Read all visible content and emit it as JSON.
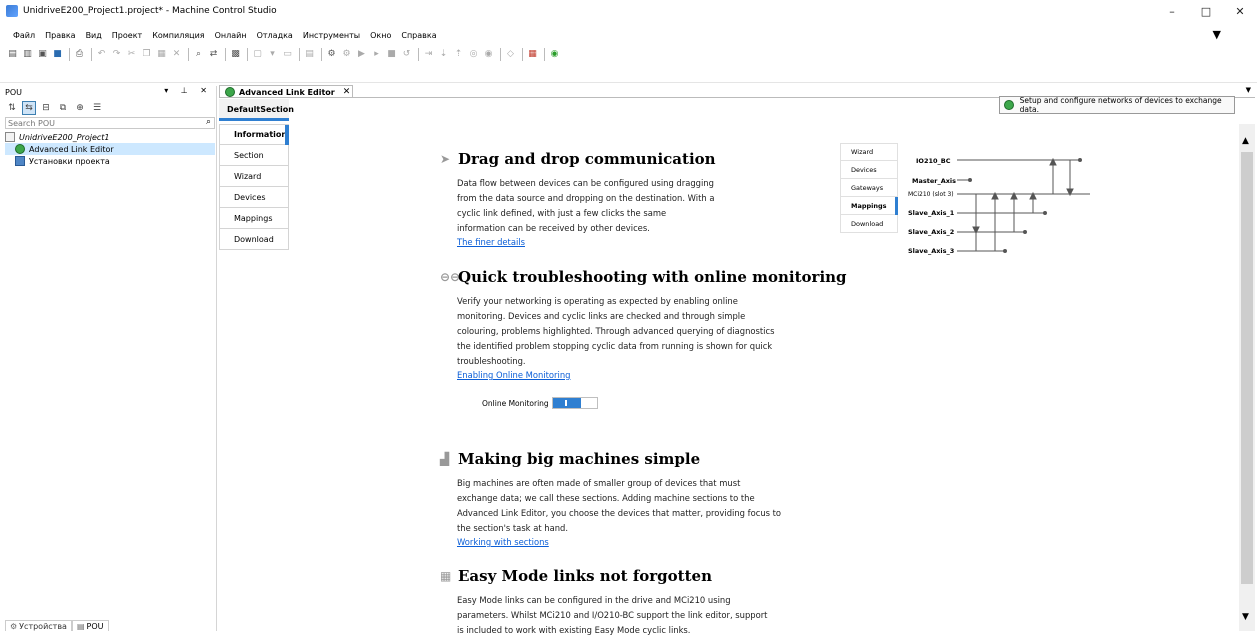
{
  "window": {
    "title": "UnidriveE200_Project1.project* - Machine Control Studio",
    "controls": [
      "–",
      "□",
      "✕"
    ]
  },
  "menu": [
    "Файл",
    "Правка",
    "Вид",
    "Проект",
    "Компиляция",
    "Онлайн",
    "Отладка",
    "Инструменты",
    "Окно",
    "Справка"
  ],
  "pou_panel": {
    "title": "POU",
    "controls": "▾ ⊥ ✕",
    "search_placeholder": "Search POU",
    "tree": {
      "project": "UnidriveE200_Project1",
      "items": [
        "Advanced Link Editor",
        "Установки проекта"
      ]
    },
    "bottom_tabs": [
      "Устройства",
      "POU"
    ]
  },
  "editor": {
    "tab_label": "Advanced Link Editor",
    "section_tab": "DefaultSection",
    "tooltip": "Setup and configure networks of devices to exchange data.",
    "nav": [
      "Information",
      "Section",
      "Wizard",
      "Devices",
      "Mappings",
      "Download"
    ],
    "active_nav": "Information"
  },
  "sections": [
    {
      "title": "Drag and drop communication",
      "icon": "cursor-icon",
      "lines": [
        "Data flow between devices can be configured using dragging",
        "from the data source and dropping on the destination. With a",
        "cyclic link defined, with just a few clicks the same",
        "information can be received by other devices."
      ],
      "link": "The finer details"
    },
    {
      "title": "Quick troubleshooting with online monitoring",
      "icon": "glasses-icon",
      "lines": [
        "Verify your networking is operating as expected by enabling online",
        "monitoring. Devices and cyclic links are checked and through simple",
        "colouring, problems highlighted. Through advanced querying of diagnostics",
        "the identified problem stopping cyclic data from running is shown for quick",
        "troubleshooting."
      ],
      "link": "Enabling Online Monitoring",
      "toggle_label": "Online Monitoring"
    },
    {
      "title": "Making big machines simple",
      "icon": "factory-icon",
      "lines": [
        "Big machines are often made of smaller group of devices that must",
        "exchange data; we call these sections. Adding machine sections to the",
        "Advanced Link Editor, you choose the devices that matter, providing focus to",
        "the section's task at hand."
      ],
      "link": "Working with sections"
    },
    {
      "title": "Easy Mode links not forgotten",
      "icon": "grid-icon",
      "lines": [
        "Easy Mode links can be configured in the drive and MCi210 using",
        "parameters. Whilst MCi210 and I/O210-BC support the link editor, support",
        "is included to work with existing Easy Mode cyclic links."
      ],
      "link": ""
    }
  ],
  "diagram": {
    "nav": [
      "Wizard",
      "Devices",
      "Gateways",
      "Mappings",
      "Download"
    ],
    "active": "Mappings",
    "devices": [
      "IO210_BC",
      "Master_Axis",
      "MCi210 (slot 3)",
      "Slave_Axis_1",
      "Slave_Axis_2",
      "Slave_Axis_3"
    ]
  }
}
